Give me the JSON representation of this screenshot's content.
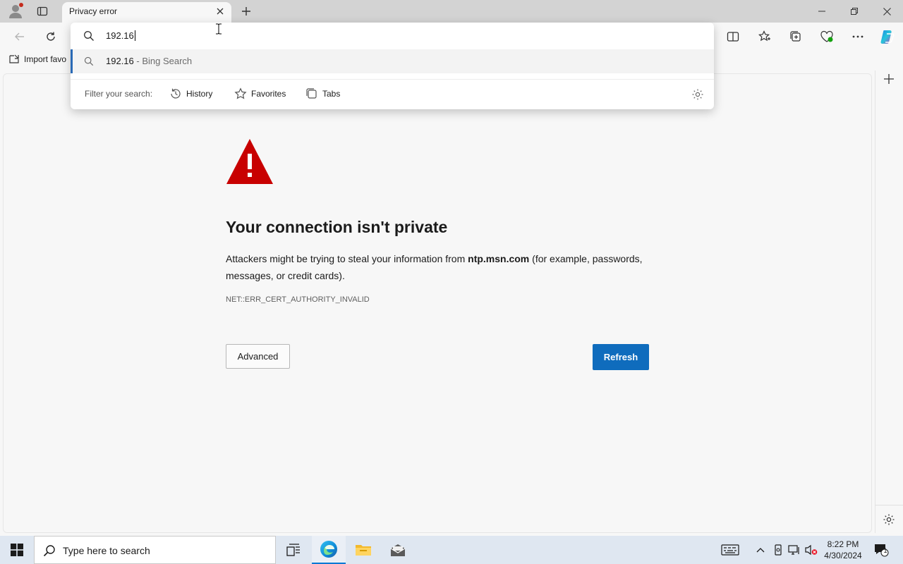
{
  "browser": {
    "tab_title": "Privacy error",
    "favorites_bar": {
      "import_label": "Import favo"
    }
  },
  "omnibox": {
    "typed_text": "192.16",
    "suggestion_query": "192.16",
    "suggestion_suffix": " - Bing Search",
    "filter_label": "Filter your search:",
    "filters": [
      "History",
      "Favorites",
      "Tabs"
    ]
  },
  "error_page": {
    "heading": "Your connection isn't private",
    "description_before": "Attackers might be trying to steal your information from ",
    "description_host": "ntp.msn.com",
    "description_after": " (for example, passwords, messages, or credit cards).",
    "error_code": "NET::ERR_CERT_AUTHORITY_INVALID",
    "advanced_label": "Advanced",
    "refresh_label": "Refresh"
  },
  "taskbar": {
    "search_placeholder": "Type here to search",
    "time": "8:22 PM",
    "date": "4/30/2024",
    "notification_count": "1"
  },
  "colors": {
    "accent": "#0f6cbd",
    "warning_red": "#c80000",
    "suggestion_marker": "#2a6ab6"
  }
}
